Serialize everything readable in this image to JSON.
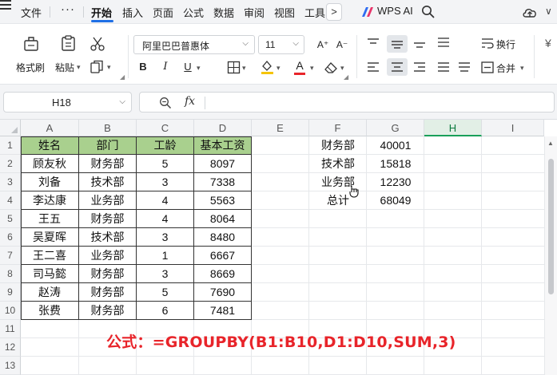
{
  "menubar": {
    "file": "文件",
    "more": "···",
    "tabs": [
      "开始",
      "插入",
      "页面",
      "公式",
      "数据",
      "审阅",
      "视图",
      "工具"
    ],
    "active_tab": "开始",
    "more_tabs_arrow": ">",
    "wps_ai": "WPS AI",
    "expand_chevron": "∨"
  },
  "ribbon": {
    "format_painter": "格式刷",
    "paste": "粘贴",
    "font_name": "阿里巴巴普惠体",
    "font_size": "11",
    "wrap": "换行",
    "merge": "合并",
    "bold": "B",
    "italic": "I",
    "underline": "U",
    "font_color_glyph": "A",
    "grow_font": "A⁺",
    "shrink_font": "A⁻",
    "partial_right": "¥"
  },
  "formula_bar": {
    "name_box": "H18",
    "fx": "fx",
    "formula": ""
  },
  "columns": [
    "A",
    "B",
    "C",
    "D",
    "E",
    "F",
    "G",
    "H",
    "I"
  ],
  "selected_column": "H",
  "rows": [
    "1",
    "2",
    "3",
    "4",
    "5",
    "6",
    "7",
    "8",
    "9",
    "10",
    "11",
    "12",
    "13"
  ],
  "table": {
    "header": [
      "姓名",
      "部门",
      "工龄",
      "基本工资"
    ],
    "rows": [
      [
        "顾友秋",
        "财务部",
        "5",
        "8097"
      ],
      [
        "刘备",
        "技术部",
        "3",
        "7338"
      ],
      [
        "李达康",
        "业务部",
        "4",
        "5563"
      ],
      [
        "王五",
        "财务部",
        "4",
        "8064"
      ],
      [
        "吴夏晖",
        "技术部",
        "3",
        "8480"
      ],
      [
        "王二喜",
        "业务部",
        "1",
        "6667"
      ],
      [
        "司马懿",
        "财务部",
        "3",
        "8669"
      ],
      [
        "赵涛",
        "财务部",
        "5",
        "7690"
      ],
      [
        "张费",
        "财务部",
        "6",
        "7481"
      ]
    ]
  },
  "groupby_result": [
    [
      "财务部",
      "40001"
    ],
    [
      "技术部",
      "15818"
    ],
    [
      "业务部",
      "12230"
    ],
    [
      "总计",
      "68049"
    ]
  ],
  "note": "公式：=GROUPBY(B1:B10,D1:D10,SUM,3)",
  "colors": {
    "header_fill": "#a9d08e",
    "note_red": "#e8242a",
    "accent_blue": "#1f6fe5",
    "selected_col_green": "#19a05a"
  }
}
